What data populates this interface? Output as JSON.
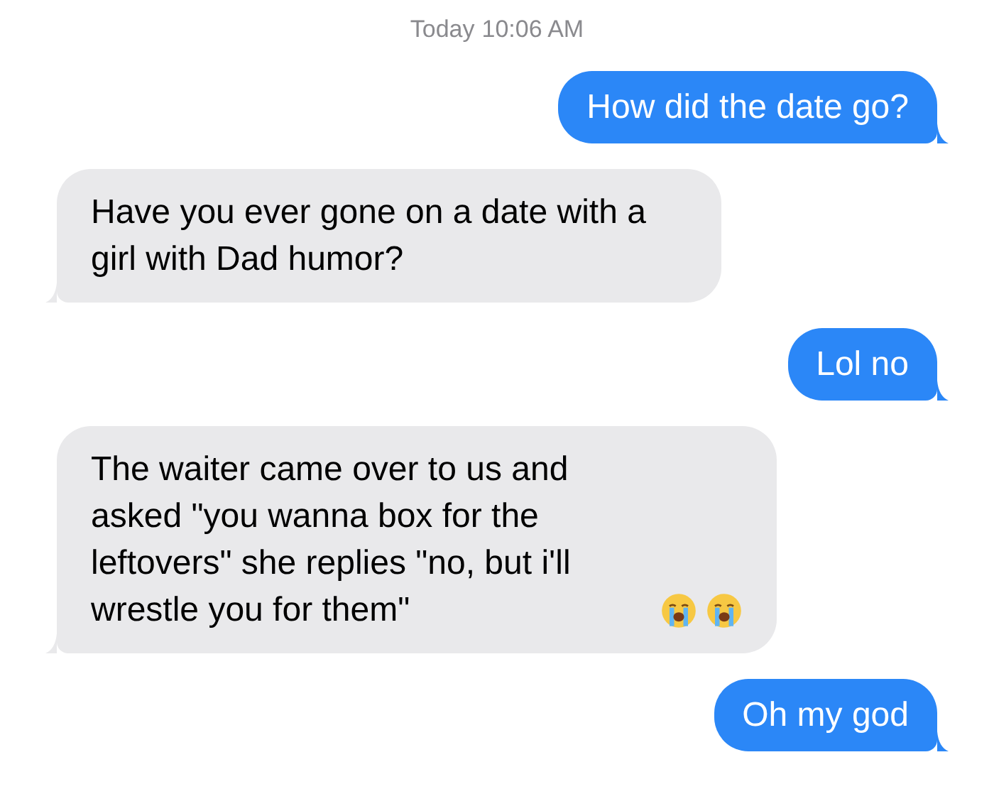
{
  "timestamp": {
    "day": "Today",
    "time": "10:06 AM"
  },
  "messages": [
    {
      "kind": "sent",
      "text": "How did the date go?"
    },
    {
      "kind": "received",
      "text": "Have you ever gone on a date with a girl with Dad humor?"
    },
    {
      "kind": "sent",
      "text": "Lol no"
    },
    {
      "kind": "received",
      "text": "The waiter came over to us and asked \"you wanna box for the leftovers\" she replies \"no, but i'll wrestle you for them\"",
      "emoji": [
        {
          "kind": "crying"
        },
        {
          "kind": "crying"
        }
      ]
    },
    {
      "kind": "sent",
      "text": "Oh my god"
    }
  ]
}
